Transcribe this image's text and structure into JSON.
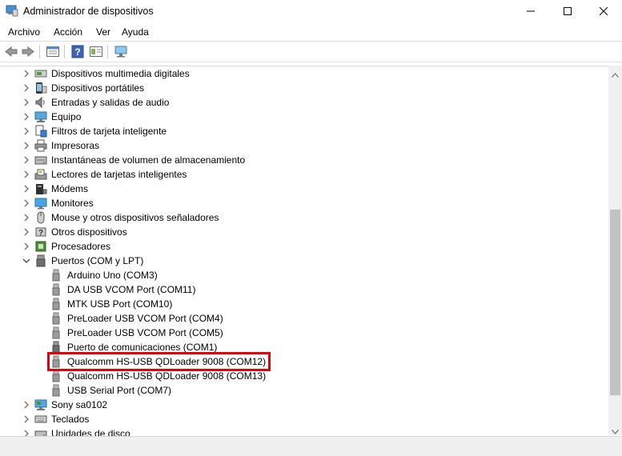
{
  "window": {
    "title": "Administrador de dispositivos",
    "controls": [
      "minimize-icon",
      "maximize-icon",
      "close-icon"
    ]
  },
  "menu": {
    "items": [
      "Archivo",
      "Acción",
      "Ver",
      "Ayuda"
    ]
  },
  "toolbar": {
    "buttons": [
      "back-icon",
      "forward-icon",
      "properties-icon",
      "help-icon",
      "view-icon",
      "scan-hardware-icon"
    ]
  },
  "tree": {
    "categories": [
      {
        "label": "Dispositivos multimedia digitales",
        "icon": "multimedia-device-icon",
        "expanded": false
      },
      {
        "label": "Dispositivos portátiles",
        "icon": "portable-device-icon",
        "expanded": false
      },
      {
        "label": "Entradas y salidas de audio",
        "icon": "audio-icon",
        "expanded": false
      },
      {
        "label": "Equipo",
        "icon": "computer-icon",
        "expanded": false
      },
      {
        "label": "Filtros de tarjeta inteligente",
        "icon": "smartcard-filter-icon",
        "expanded": false
      },
      {
        "label": "Impresoras",
        "icon": "printer-icon",
        "expanded": false
      },
      {
        "label": "Instantáneas de volumen de almacenamiento",
        "icon": "storage-snapshot-icon",
        "expanded": false
      },
      {
        "label": "Lectores de tarjetas inteligentes",
        "icon": "smartcard-reader-icon",
        "expanded": false
      },
      {
        "label": "Módems",
        "icon": "modem-icon",
        "expanded": false
      },
      {
        "label": "Monitores",
        "icon": "monitor-icon",
        "expanded": false
      },
      {
        "label": "Mouse y otros dispositivos señaladores",
        "icon": "mouse-icon",
        "expanded": false
      },
      {
        "label": "Otros dispositivos",
        "icon": "other-devices-icon",
        "expanded": false
      },
      {
        "label": "Procesadores",
        "icon": "processor-icon",
        "expanded": false
      },
      {
        "label": "Puertos (COM y LPT)",
        "icon": "port-icon",
        "expanded": true
      }
    ],
    "ports": [
      "Arduino Uno (COM3)",
      "DA USB VCOM Port (COM11)",
      "MTK USB Port (COM10)",
      "PreLoader USB VCOM Port (COM4)",
      "PreLoader USB VCOM Port (COM5)",
      "Puerto de comunicaciones (COM1)",
      "Qualcomm HS-USB QDLoader 9008 (COM12)",
      "Qualcomm HS-USB QDLoader 9008 (COM13)",
      "USB Serial Port (COM7)"
    ],
    "highlighted_port": "Qualcomm HS-USB QDLoader 9008 (COM12)",
    "after": [
      {
        "label": "Sony sa0102",
        "icon": "computer-icon"
      },
      {
        "label": "Teclados",
        "icon": "keyboard-icon"
      },
      {
        "label": "Unidades de disco",
        "icon": "disk-drive-icon"
      }
    ]
  },
  "colors": {
    "highlight_border": "#e3000f",
    "text": "#000000",
    "chevron": "#6d6d6d"
  }
}
